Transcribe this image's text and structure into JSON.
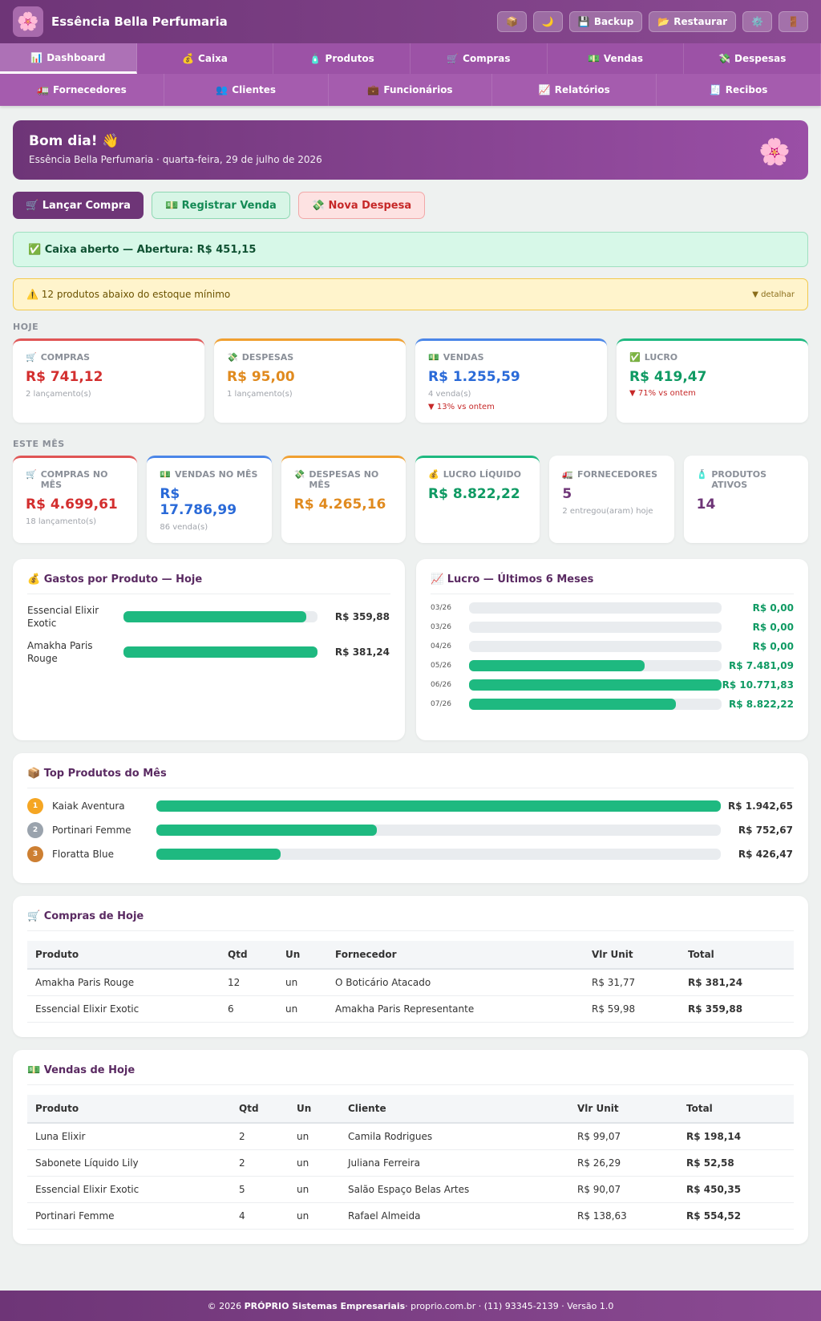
{
  "header": {
    "brand": "Essência Bella Perfumaria",
    "logo_icon": "🌸",
    "buttons": [
      {
        "icon": "📦",
        "label": ""
      },
      {
        "icon": "🌙",
        "label": ""
      },
      {
        "icon": "💾",
        "label": "Backup"
      },
      {
        "icon": "📂",
        "label": "Restaurar"
      },
      {
        "icon": "⚙️",
        "label": ""
      },
      {
        "icon": "🚪",
        "label": ""
      }
    ]
  },
  "nav": {
    "row1": [
      {
        "icon": "📊",
        "label": "Dashboard"
      },
      {
        "icon": "💰",
        "label": "Caixa"
      },
      {
        "icon": "🧴",
        "label": "Produtos"
      },
      {
        "icon": "🛒",
        "label": "Compras"
      },
      {
        "icon": "💵",
        "label": "Vendas"
      },
      {
        "icon": "💸",
        "label": "Despesas"
      }
    ],
    "row2": [
      {
        "icon": "🚛",
        "label": "Fornecedores"
      },
      {
        "icon": "👥",
        "label": "Clientes"
      },
      {
        "icon": "💼",
        "label": "Funcionários"
      },
      {
        "icon": "📈",
        "label": "Relatórios"
      },
      {
        "icon": "🧾",
        "label": "Recibos"
      }
    ]
  },
  "greeting": {
    "title": "Bom dia! 👋",
    "subtitle": "Essência Bella Perfumaria · quarta-feira, 29 de julho de 2026",
    "icon": "🌸"
  },
  "actions": {
    "buy": "🛒 Lançar Compra",
    "sale": "💵 Registrar Venda",
    "expense": "💸 Nova Despesa"
  },
  "alerts": {
    "cash": "✅ Caixa aberto — Abertura: R$ 451,15",
    "stock": "⚠️ 12 produtos abaixo do estoque mínimo",
    "stock_detail": "▼ detalhar"
  },
  "today": {
    "label": "HOJE",
    "cards": [
      {
        "icon": "🛒",
        "label": "COMPRAS",
        "value": "R$ 741,12",
        "sub": "2 lançamento(s)",
        "cmp": ""
      },
      {
        "icon": "💸",
        "label": "DESPESAS",
        "value": "R$ 95,00",
        "sub": "1 lançamento(s)",
        "cmp": ""
      },
      {
        "icon": "💵",
        "label": "VENDAS",
        "value": "R$ 1.255,59",
        "sub": "4 venda(s)",
        "cmp": "▼ 13% vs ontem"
      },
      {
        "icon": "✅",
        "label": "LUCRO",
        "value": "R$ 419,47",
        "sub": "",
        "cmp": "▼ 71% vs ontem"
      }
    ]
  },
  "month": {
    "label": "ESTE MÊS",
    "cards": [
      {
        "icon": "🛒",
        "label": "COMPRAS NO MÊS",
        "value": "R$ 4.699,61",
        "sub": "18 lançamento(s)"
      },
      {
        "icon": "💵",
        "label": "VENDAS NO MÊS",
        "value": "R$ 17.786,99",
        "sub": "86 venda(s)"
      },
      {
        "icon": "💸",
        "label": "DESPESAS NO MÊS",
        "value": "R$ 4.265,16",
        "sub": ""
      },
      {
        "icon": "💰",
        "label": "LUCRO LÍQUIDO",
        "value": "R$ 8.822,22",
        "sub": ""
      },
      {
        "icon": "🚛",
        "label": "FORNECEDORES",
        "value": "5",
        "sub": "2 entregou(aram) hoje"
      },
      {
        "icon": "🧴",
        "label": "PRODUTOS ATIVOS",
        "value": "14",
        "sub": ""
      }
    ]
  },
  "spend_panel": {
    "title": "💰 Gastos por Produto — Hoje",
    "rows": [
      {
        "name": "Essencial Elixir Exotic",
        "value": "R$ 359,88",
        "fraction": 0.944
      },
      {
        "name": "Amakha Paris Rouge",
        "value": "R$ 381,24",
        "fraction": 1.0
      }
    ]
  },
  "profit_panel": {
    "title": "📈 Lucro — Últimos 6 Meses",
    "rows": [
      {
        "month": "03/26",
        "value": "R$ 0,00",
        "fraction": 0
      },
      {
        "month": "03/26",
        "value": "R$ 0,00",
        "fraction": 0
      },
      {
        "month": "04/26",
        "value": "R$ 0,00",
        "fraction": 0
      },
      {
        "month": "05/26",
        "value": "R$ 7.481,09",
        "fraction": 0.695
      },
      {
        "month": "06/26",
        "value": "R$ 10.771,83",
        "fraction": 1.0
      },
      {
        "month": "07/26",
        "value": "R$ 8.822,22",
        "fraction": 0.819
      }
    ]
  },
  "top_panel": {
    "title": "📦 Top Produtos do Mês",
    "rows": [
      {
        "rank": "1",
        "name": "Kaiak Aventura",
        "value": "R$ 1.942,65",
        "fraction": 1.0,
        "color": "#f5a623"
      },
      {
        "rank": "2",
        "name": "Portinari Femme",
        "value": "R$ 752,67",
        "fraction": 0.39,
        "color": "#9aa3ad"
      },
      {
        "rank": "3",
        "name": "Floratta Blue",
        "value": "R$ 426,47",
        "fraction": 0.22,
        "color": "#cd7f32"
      }
    ]
  },
  "purchases": {
    "title": "🛒 Compras de Hoje",
    "headers": [
      "Produto",
      "Qtd",
      "Un",
      "Fornecedor",
      "Vlr Unit",
      "Total"
    ],
    "rows": [
      [
        "Amakha Paris Rouge",
        "12",
        "un",
        "O Boticário Atacado",
        "R$ 31,77",
        "R$ 381,24"
      ],
      [
        "Essencial Elixir Exotic",
        "6",
        "un",
        "Amakha Paris Representante",
        "R$ 59,98",
        "R$ 359,88"
      ]
    ]
  },
  "sales": {
    "title": "💵 Vendas de Hoje",
    "headers": [
      "Produto",
      "Qtd",
      "Un",
      "Cliente",
      "Vlr Unit",
      "Total"
    ],
    "rows": [
      [
        "Luna Elixir",
        "2",
        "un",
        "Camila Rodrigues",
        "R$ 99,07",
        "R$ 198,14"
      ],
      [
        "Sabonete Líquido Lily",
        "2",
        "un",
        "Juliana Ferreira",
        "R$ 26,29",
        "R$ 52,58"
      ],
      [
        "Essencial Elixir Exotic",
        "5",
        "un",
        "Salão Espaço Belas Artes",
        "R$ 90,07",
        "R$ 450,35"
      ],
      [
        "Portinari Femme",
        "4",
        "un",
        "Rafael Almeida",
        "R$ 138,63",
        "R$ 554,52"
      ]
    ]
  },
  "footer": {
    "prefix": "© 2026 ",
    "company": "PRÓPRIO Sistemas Empresariais",
    "rest": " · proprio.com.br · (11) 93345-2139 · Versão 1.0"
  }
}
